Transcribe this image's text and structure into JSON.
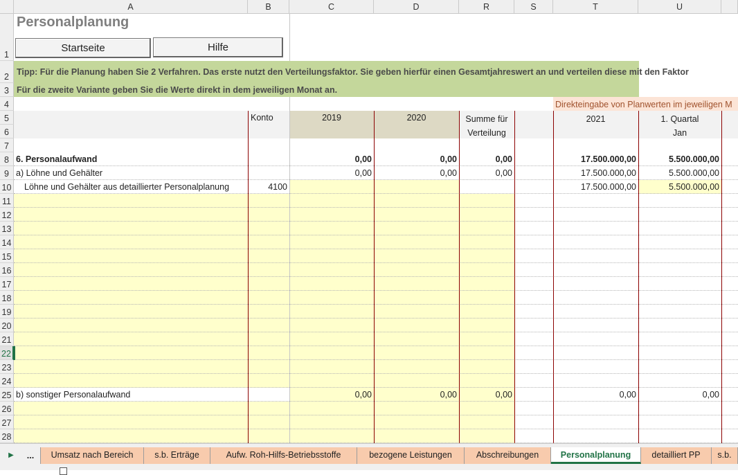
{
  "columns": [
    "A",
    "B",
    "C",
    "D",
    "R",
    "S",
    "T",
    "U"
  ],
  "rows": [
    "1",
    "2",
    "3",
    "4",
    "5",
    "6",
    "7",
    "8",
    "9",
    "10",
    "11",
    "12",
    "13",
    "14",
    "15",
    "16",
    "17",
    "18",
    "19",
    "20",
    "21",
    "22",
    "23",
    "24",
    "25",
    "26",
    "27",
    "28"
  ],
  "title": "Personalplanung",
  "buttons": {
    "start": "Startseite",
    "help": "Hilfe"
  },
  "tip": {
    "line1": "Tipp: Für die Planung haben Sie 2 Verfahren. Das erste nutzt den Verteilungsfaktor. Sie geben hierfür einen Gesamtjahreswert an und verteilen diese mit den Faktor",
    "line2": "Für die zweite Variante geben Sie die Werte direkt in dem jeweiligen Monat an."
  },
  "direct_entry_note": "Direkteingabe von Planwerten im jeweiligen M",
  "headers": {
    "konto": "Konto",
    "y2019": "2019",
    "y2020": "2020",
    "summe_line1": "Summe für",
    "summe_line2": "Verteilung",
    "y2021": "2021",
    "quarter": "1. Quartal",
    "month": "Jan"
  },
  "data_rows": {
    "r8": {
      "label": "6. Personalaufwand",
      "c": "0,00",
      "d": "0,00",
      "r": "0,00",
      "t": "17.500.000,00",
      "u": "5.500.000,00"
    },
    "r9": {
      "label": "a) Löhne und Gehälter",
      "c": "0,00",
      "d": "0,00",
      "r": "0,00",
      "t": "17.500.000,00",
      "u": "5.500.000,00"
    },
    "r10": {
      "label": "Löhne und Gehälter aus detaillierter Personalplanung",
      "b": "4100",
      "t": "17.500.000,00",
      "u": "5.500.000,00"
    },
    "r25": {
      "label": "b) sonstiger Personalaufwand",
      "c": "0,00",
      "d": "0,00",
      "r": "0,00",
      "t": "0,00",
      "u": "0,00"
    }
  },
  "sheet_tabs": {
    "more": "...",
    "items": [
      "Umsatz nach Bereich",
      "s.b. Erträge",
      "Aufw. Roh-Hilfs-Betriebsstoffe",
      "bezogene Leistungen",
      "Abschreibungen",
      "Personalplanung",
      "detailliert PP",
      "s.b."
    ],
    "active": "Personalplanung"
  },
  "colors": {
    "tip_bg": "#c4d79b",
    "input_yellow": "#ffffcc",
    "year_header_bg": "#ddd9c4",
    "direct_note_bg": "#fce4d6",
    "tab_bg": "#f8cbad",
    "accent": "#217346",
    "separator": "#8b0000"
  }
}
